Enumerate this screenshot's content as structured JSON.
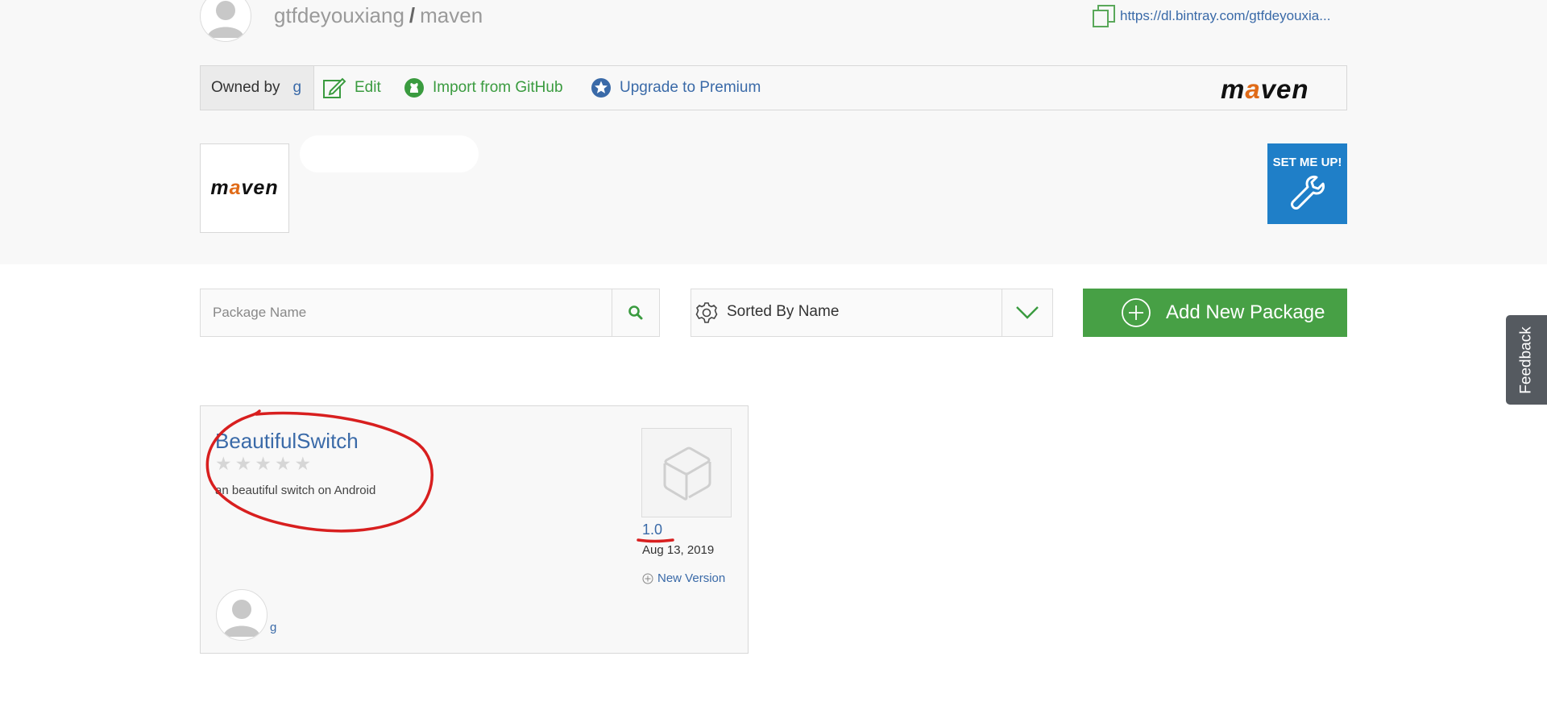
{
  "header": {
    "owner": "gtfdeyouxiang",
    "separator": "/",
    "repo": "maven",
    "url": "https://dl.bintray.com/gtfdeyouxia..."
  },
  "toolbar": {
    "owned_by_label": "Owned by",
    "owner_initial": "g",
    "edit_label": "Edit",
    "import_label": "Import from GitHub",
    "upgrade_label": "Upgrade to Premium",
    "logo_text_pre": "m",
    "logo_text_a": "a",
    "logo_text_post": "ven"
  },
  "repo_box": {
    "logo_text_pre": "m",
    "logo_text_a": "a",
    "logo_text_post": "ven",
    "setup_label": "SET ME UP!"
  },
  "controls": {
    "search_placeholder": "Package Name",
    "sort_label": "Sorted By Name",
    "add_label": "Add New Package"
  },
  "feedback_label": "Feedback",
  "packages": [
    {
      "name": "BeautifulSwitch",
      "rating": 0,
      "max_rating": 5,
      "description": "an beautiful switch on Android",
      "version": "1.0",
      "date": "Aug 13, 2019",
      "new_version_label": "New Version",
      "owner": "g"
    }
  ],
  "colors": {
    "accent_green": "#47a045",
    "link_blue": "#3a6aa8",
    "setup_blue": "#1f7fc8",
    "annotation_red": "#d81f1f"
  }
}
